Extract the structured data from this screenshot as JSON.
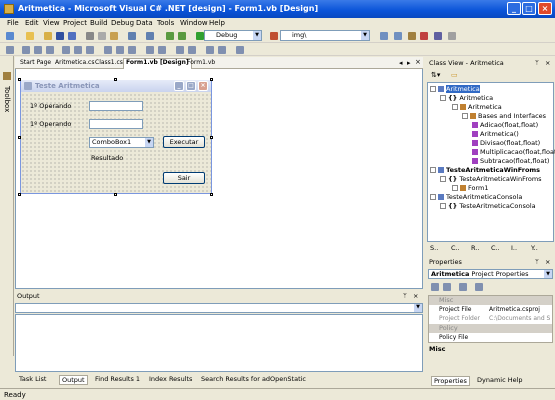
{
  "window": {
    "title": "Aritmetica - Microsoft Visual C# .NET [design] - Form1.vb [Design]"
  },
  "menu": [
    "File",
    "Edit",
    "View",
    "Project",
    "Build",
    "Debug",
    "Data",
    "Tools",
    "Window",
    "Help"
  ],
  "toolbar": {
    "config": "Debug",
    "find": "img\\"
  },
  "toolbox": {
    "label": "Toolbox"
  },
  "doc_tabs": [
    "Start Page",
    "Aritmetica.cs",
    "Class1.cs",
    "Form1.vb [Design]",
    "Form1.vb"
  ],
  "form": {
    "title": "Teste Aritmetica",
    "label1": "1º Operando",
    "label2": "1º Operando",
    "combo": "ComboBox1",
    "result": "Resultado",
    "btn_exec": "Executar",
    "btn_exit": "Sair"
  },
  "classview": {
    "title": "Class View - Aritmetica",
    "nodes": [
      "Aritmetica",
      "Aritmetica",
      "Aritmetica",
      "Bases and Interfaces",
      "Adicao(float,float)",
      "Aritmetica()",
      "Divisao(float,float)",
      "Multiplicacao(float,float)",
      "Subtracao(float,float)",
      "TesteAritmeticaWinFroms",
      "TesteAritmeticaWinFroms",
      "Form1",
      "TesteAritmeticaConsola",
      "TesteAritmeticaConsola"
    ],
    "tabs": [
      "S..",
      "C..",
      "R..",
      "C..",
      "I..",
      "Y.."
    ]
  },
  "properties": {
    "title": "Properties",
    "object": "Aritmetica",
    "object_type": "Project Properties",
    "cat_misc": "Misc",
    "rows": [
      [
        "Project File",
        "Aritmetica.csproj"
      ],
      [
        "Project Folder",
        "C:\\Documents and S..."
      ]
    ],
    "cat_policy": "Policy",
    "policy_row": "Policy File",
    "desc": "Misc",
    "tabs": [
      "Properties",
      "Dynamic Help"
    ]
  },
  "output": {
    "title": "Output"
  },
  "bottom_tabs": [
    "Task List",
    "Output",
    "Find Results 1",
    "Index Results",
    "Search Results for adOpenStatic"
  ],
  "status": "Ready"
}
